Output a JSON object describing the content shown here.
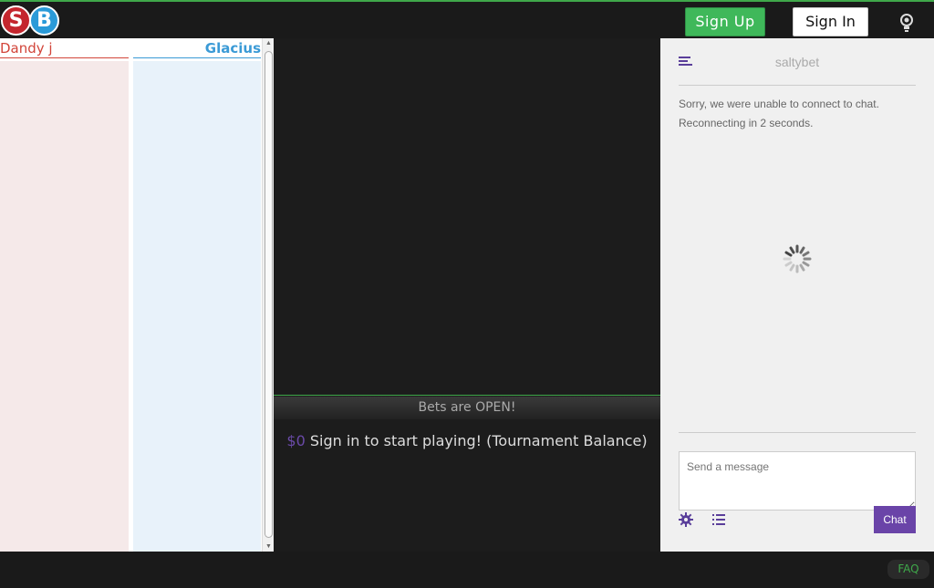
{
  "header": {
    "logo": {
      "s": "S",
      "b": "B"
    },
    "signup_label": "Sign Up",
    "signin_label": "Sign In",
    "bulb_icon": "lightbulb-icon"
  },
  "fighters": {
    "red": {
      "name": "Dandy j",
      "color": "#d2453a"
    },
    "blue": {
      "name": "Glacius",
      "color": "#3a9ad6"
    }
  },
  "betting": {
    "status": "Bets are OPEN!",
    "balance_symbol": "$0",
    "balance_text": "Sign in to start playing! (Tournament Balance)"
  },
  "chat": {
    "title": "saltybet",
    "messages": [
      "Sorry, we were unable to connect to chat.",
      "Reconnecting in 2 seconds."
    ],
    "input_placeholder": "Send a message",
    "send_label": "Chat",
    "accent": "#6a44a8"
  },
  "footer": {
    "faq_label": "FAQ"
  }
}
